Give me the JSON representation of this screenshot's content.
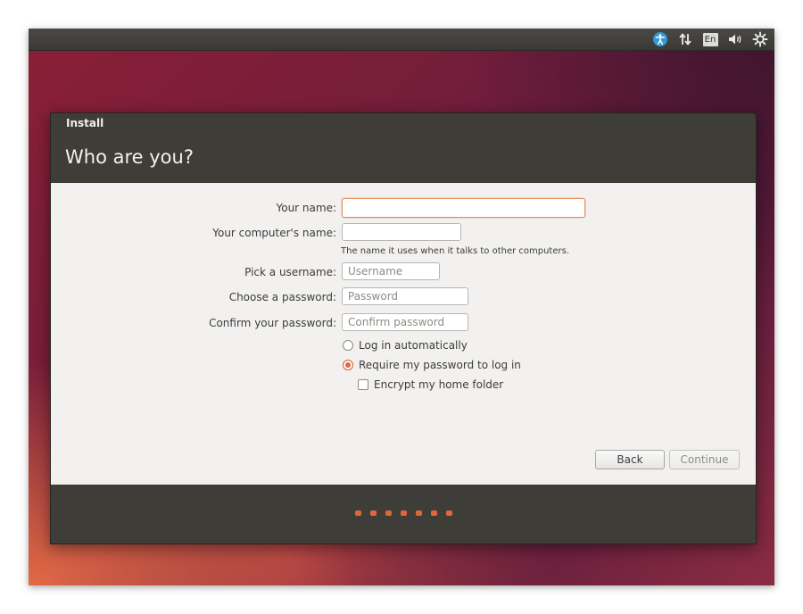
{
  "topbar": {
    "icons": [
      "accessibility-icon",
      "network-icon",
      "keyboard-layout-icon",
      "volume-icon",
      "power-settings-icon"
    ],
    "keyboard_layout": "En"
  },
  "window": {
    "title": "Install",
    "heading": "Who are you?"
  },
  "form": {
    "your_name": {
      "label": "Your name:",
      "value": ""
    },
    "computer_name": {
      "label": "Your computer's name:",
      "value": "",
      "hint": "The name it uses when it talks to other computers."
    },
    "username": {
      "label": "Pick a username:",
      "placeholder": "Username"
    },
    "password": {
      "label": "Choose a password:",
      "placeholder": "Password"
    },
    "confirm_password": {
      "label": "Confirm your password:",
      "placeholder": "Confirm password"
    },
    "login_options": [
      {
        "label": "Log in automatically",
        "selected": false
      },
      {
        "label": "Require my password to log in",
        "selected": true
      }
    ],
    "encrypt_home": {
      "label": "Encrypt my home folder",
      "checked": false
    }
  },
  "buttons": {
    "back": "Back",
    "continue": "Continue"
  },
  "progress": {
    "steps": 7
  },
  "colors": {
    "accent": "#e0673b",
    "header": "#3e3d38",
    "body": "#f2f1f0"
  }
}
